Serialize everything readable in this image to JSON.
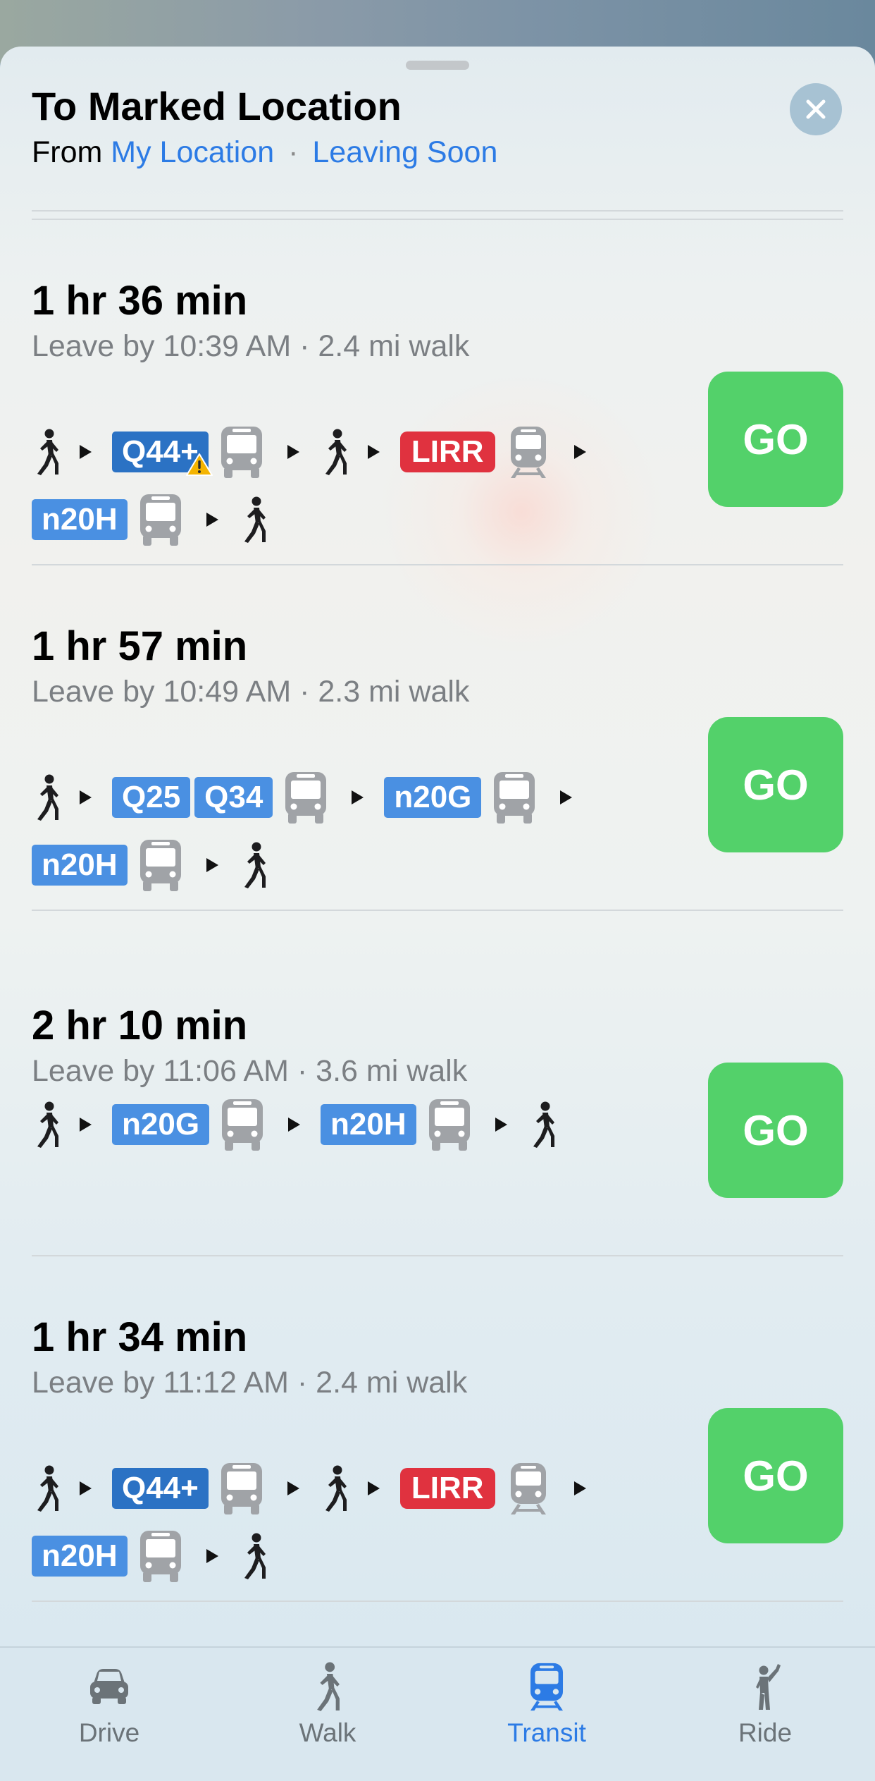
{
  "header": {
    "title": "To Marked Location",
    "from_label": "From",
    "origin": "My Location",
    "separator": "·",
    "time_option": "Leaving Soon"
  },
  "go_label": "GO",
  "routes": [
    {
      "duration": "1 hr 36 min",
      "leave": "Leave by 10:39 AM · 2.4 mi walk",
      "badges": [
        "Q44+",
        "LIRR",
        "n20H"
      ],
      "advisory": "warning-icon"
    },
    {
      "duration": "1 hr 57 min",
      "leave": "Leave by 10:49 AM · 2.3 mi walk",
      "badges": [
        "Q25",
        "Q34",
        "n20G",
        "n20H"
      ]
    },
    {
      "duration": "2 hr 10 min",
      "leave": "Leave by 11:06 AM · 3.6 mi walk",
      "badges": [
        "n20G",
        "n20H"
      ]
    },
    {
      "duration": "1 hr 34 min",
      "leave": "Leave by 11:12 AM · 2.4 mi walk",
      "badges": [
        "Q44+",
        "LIRR",
        "n20H"
      ]
    }
  ],
  "tabs": [
    {
      "label": "Drive",
      "icon": "car-icon"
    },
    {
      "label": "Walk",
      "icon": "walk-icon"
    },
    {
      "label": "Transit",
      "icon": "train-icon",
      "selected": true
    },
    {
      "label": "Ride",
      "icon": "hail-icon"
    }
  ],
  "colors": {
    "go": "#53d16a",
    "link": "#2c7be5",
    "bus_badge": "#4a90e2",
    "select_bus_badge": "#2b72c4",
    "rail_badge": "#e0323f"
  }
}
